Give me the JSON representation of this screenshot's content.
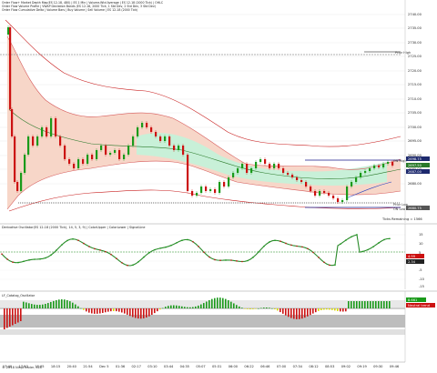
{
  "header": {
    "line1": "Order Flow+ Market Depth Map(ES 12-18, 480) | ES 1 Min | Volume-Wtd Average | ES 12-18 (2000 Tick) | OHLC",
    "line2": "Order Flow Volume Profile | VWAP Deviation Bands (ES 12-18, 2000 Tick, 1 Std Dev, 2 Std Dev, 3 Std Dev)",
    "line3": "Order Flow Cumulative Delta | Volume Bars | Buy Volume | Sell Volume | ES 12-18 (2000 Tick)"
  },
  "price_axis": {
    "labels": [
      "2740.00",
      "2735.00",
      "2730.00",
      "2725.00",
      "2720.00",
      "2715.00",
      "2710.00",
      "2705.00",
      "2700.00",
      "2695.00",
      "2690.00",
      "2685.00",
      "2680.00"
    ],
    "current_price": "2698.75",
    "tag_a": "2697.50",
    "tag_b": "2687.00",
    "tag_c": "2680.75"
  },
  "annotations": {
    "prior_high": "Prior High",
    "ovn_high": "ON High",
    "prior_low": "Prior Low",
    "ovn_low": "ON Low",
    "ticks_remaining": "Ticks Remaining = 1566"
  },
  "osc_panel": {
    "title": "Derivative Oscillator(ES 12-18 (2000 Tick), 14, 5, 3, 9) | ColorUpper | ColorLower | SignalLine",
    "labels": [
      "15",
      "10",
      "5",
      "0",
      "-5",
      "-10",
      "-15"
    ],
    "value_a": "4.99",
    "value_b": "2.34"
  },
  "vol_panel": {
    "title": "LF_Catalog_Oscillator",
    "value_a": "8.661",
    "value_b": "Neutral trend"
  },
  "time_axis": [
    "17:40",
    "17:53",
    "18:05",
    "18:15",
    "20:40",
    "21:54",
    "Dec 5",
    "01:36",
    "02:17",
    "03:10",
    "03:44",
    "04:35",
    "05:07",
    "05:31",
    "06:00",
    "06:22",
    "06:46",
    "07:00",
    "07:34",
    "08:12",
    "08:53",
    "09:02",
    "09:19",
    "09:30",
    "09:46"
  ],
  "copyright": "© 2018 NinjaTrader, LLC",
  "colors": {
    "bull": "#1a9a1a",
    "bear": "#cc1111",
    "band_fill": "#f7d6c8",
    "inner_fill": "#c8f0d8",
    "price_tag": "#1e2a6e",
    "neutral_yellow": "#d8d800",
    "ovn_line": "#1a1a8a"
  }
}
